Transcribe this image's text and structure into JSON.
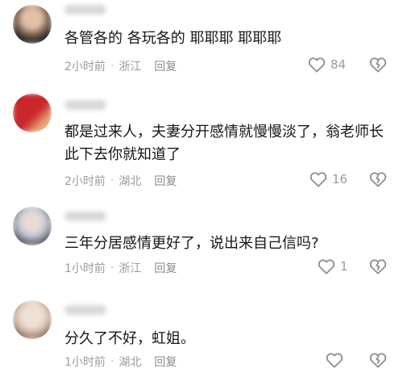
{
  "comments": [
    {
      "text": "各管各的  各玩各的  耶耶耶  耶耶耶",
      "time": "2小时前",
      "location": "浙江",
      "reply": "回复",
      "likes": "84",
      "avatar_colors": [
        "#cfa58c",
        "#2b2b2b"
      ]
    },
    {
      "text": "都是过来人，夫妻分开感情就慢慢淡了，翁老师长此下去你就知道了",
      "time": "2小时前",
      "location": "湖北",
      "reply": "回复",
      "likes": "16",
      "avatar_colors": [
        "#c9272c",
        "#e7b17a"
      ]
    },
    {
      "text": "三年分居感情更好了，说出来自己信吗?",
      "time": "1小时前",
      "location": "浙江",
      "reply": "回复",
      "likes": "1",
      "avatar_colors": [
        "#c7c9d6",
        "#5a5a6a"
      ]
    },
    {
      "text": "分久了不好，虹姐。",
      "time": "1小时前",
      "location": "湖北",
      "reply": "回复",
      "likes": "",
      "avatar_colors": [
        "#e6d3c4",
        "#8a6a5a"
      ]
    }
  ],
  "icons": {
    "like": "heart-outline-icon",
    "dislike": "broken-heart-outline-icon"
  },
  "colors": {
    "text": "#161616",
    "meta": "#9b9b9b",
    "icon": "#8e8e8e"
  }
}
